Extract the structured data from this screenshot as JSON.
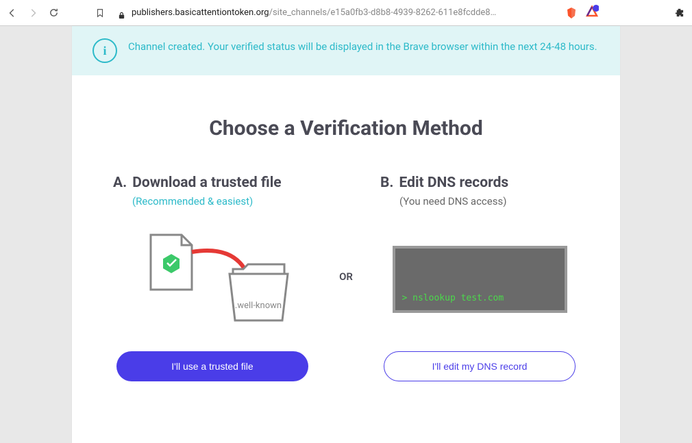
{
  "browser": {
    "url_host": "publishers.basicattentiontoken.org",
    "url_path": "/site_channels/e15a0fb3-d8b8-4939-8262-611e8fcdde8…"
  },
  "banner": {
    "text": "Channel created. Your verified status will be displayed in the Brave browser within the next 24-48 hours."
  },
  "heading": "Choose a Verification Method",
  "option_a": {
    "letter": "A.",
    "title": "Download a trusted file",
    "subtitle": "(Recommended & easiest)",
    "folder_label": ".well-known",
    "button": "I'll use a trusted file"
  },
  "divider": "OR",
  "option_b": {
    "letter": "B.",
    "title": "Edit DNS records",
    "subtitle": "(You need DNS access)",
    "terminal": "> nslookup test.com",
    "button": "I'll edit my DNS record"
  }
}
